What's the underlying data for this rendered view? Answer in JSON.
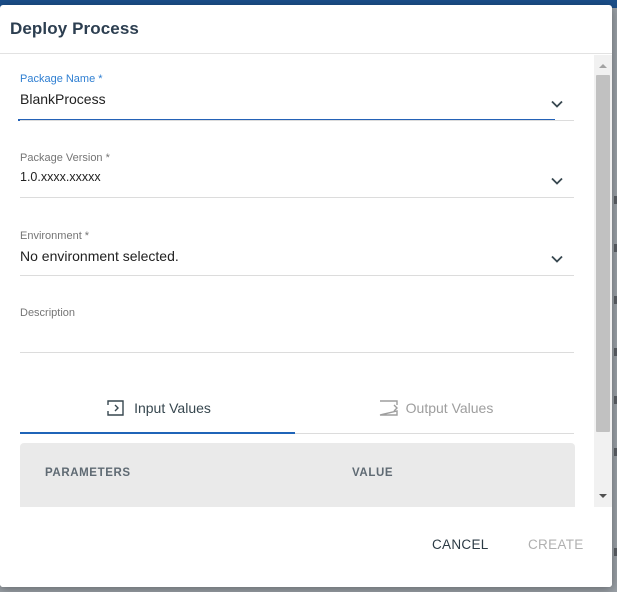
{
  "dialog": {
    "title": "Deploy Process"
  },
  "fields": {
    "package_name": {
      "label": "Package Name *",
      "value": "BlankProcess"
    },
    "package_version": {
      "label": "Package Version *",
      "value": "1.0.xxxx.xxxxx"
    },
    "environment": {
      "label": "Environment *",
      "value": "No environment selected."
    },
    "description": {
      "label": "Description",
      "value": ""
    }
  },
  "tabs": [
    {
      "label": "Input Values",
      "active": true
    },
    {
      "label": "Output Values",
      "active": false
    }
  ],
  "table": {
    "columns": [
      "PARAMETERS",
      "VALUE"
    ]
  },
  "footer": {
    "cancel_label": "CANCEL",
    "create_label": "CREATE"
  },
  "colors": {
    "accent": "#2462b7",
    "label_active": "#2f7fd2",
    "disabled": "#b0b0b0"
  },
  "icons": {
    "dropdown": "chevron-down-icon",
    "input_tab": "input-arrow-icon",
    "output_tab": "output-arrow-icon"
  }
}
